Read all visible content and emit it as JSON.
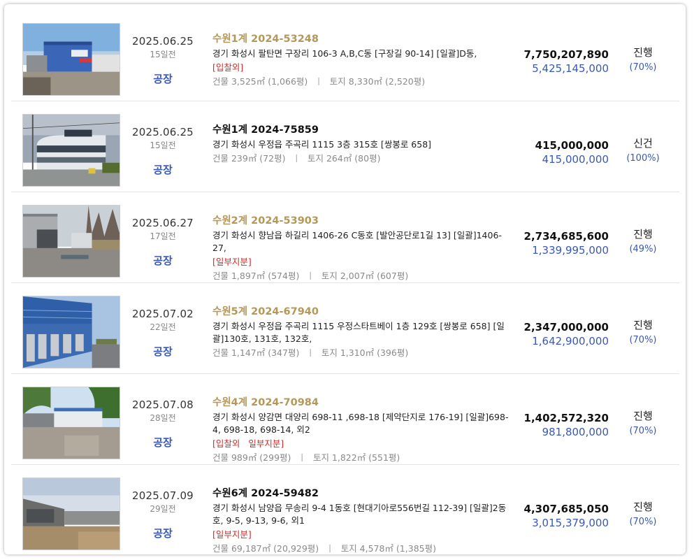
{
  "listings": [
    {
      "date": "2025.06.25",
      "days_left": "15일전",
      "category": "공장",
      "case_no": "수원1계 2024-53248",
      "case_style": "gold",
      "address": "경기 화성시 팔탄면 구장리 106-3 A,B,C동 [구장길 90-14] [일괄]D동,",
      "tags": [
        "[입찰외]"
      ],
      "building_area": "건물 3,525㎡ (1,066평)",
      "land_area": "토지 8,330㎡ (2,520평)",
      "appraised_price": "7,750,207,890",
      "min_price": "5,425,145,000",
      "status": "진행",
      "percent": "(70%)"
    },
    {
      "date": "2025.06.25",
      "days_left": "15일전",
      "category": "공장",
      "case_no": "수원1계 2024-75859",
      "case_style": "black",
      "address": "경기 화성시 우정읍 주곡리 1115 3층 315호 [쌍봉로 658]",
      "tags": [],
      "building_area": "건물 239㎡ (72평)",
      "land_area": "토지 264㎡ (80평)",
      "appraised_price": "415,000,000",
      "min_price": "415,000,000",
      "status": "신건",
      "percent": "(100%)"
    },
    {
      "date": "2025.06.27",
      "days_left": "17일전",
      "category": "공장",
      "case_no": "수원2계 2024-53903",
      "case_style": "gold",
      "address": "경기 화성시 향남읍 하길리 1406-26 C동호 [발안공단로1길 13] [일괄]1406-27,",
      "tags": [
        "[일부지분]"
      ],
      "building_area": "건물 1,897㎡ (574평)",
      "land_area": "토지 2,007㎡ (607평)",
      "appraised_price": "2,734,685,600",
      "min_price": "1,339,995,000",
      "status": "진행",
      "percent": "(49%)"
    },
    {
      "date": "2025.07.02",
      "days_left": "22일전",
      "category": "공장",
      "case_no": "수원5계 2024-67940",
      "case_style": "gold",
      "address": "경기 화성시 우정읍 주곡리 1115 우정스타트베이 1층 129호 [쌍봉로 658] [일괄]130호, 131호, 132호,",
      "tags": [],
      "building_area": "건물 1,147㎡ (347평)",
      "land_area": "토지 1,310㎡ (396평)",
      "appraised_price": "2,347,000,000",
      "min_price": "1,642,900,000",
      "status": "진행",
      "percent": "(70%)"
    },
    {
      "date": "2025.07.08",
      "days_left": "28일전",
      "category": "공장",
      "case_no": "수원4계 2024-70984",
      "case_style": "gold",
      "address": "경기 화성시 양감면 대양리 698-11 ,698-18 [제약단지로 176-19] [일괄]698-4, 698-18, 698-14, 외2",
      "tags": [
        "[입찰외",
        "일부지분]"
      ],
      "building_area": "건물 989㎡ (299평)",
      "land_area": "토지 1,822㎡ (551평)",
      "appraised_price": "1,402,572,320",
      "min_price": "981,800,000",
      "status": "진행",
      "percent": "(70%)"
    },
    {
      "date": "2025.07.09",
      "days_left": "29일전",
      "category": "공장",
      "case_no": "수원6계 2024-59482",
      "case_style": "black",
      "address": "경기 화성시 남양읍 무송리 9-4 1동호 [현대기아로556번길 112-39] [일괄]2동호, 9-5, 9-13, 9-6, 외1",
      "tags": [
        "[일부지분]"
      ],
      "building_area": "건물 69,187㎡ (20,929평)",
      "land_area": "토지 4,578㎡ (1,385평)",
      "appraised_price": "4,307,685,050",
      "min_price": "3,015,379,000",
      "status": "진행",
      "percent": "(70%)"
    }
  ],
  "area_separator": "ㅣ",
  "thumbnails": [
    "factory-blue-building-photo",
    "factory-round-building-photo",
    "factory-yard-photo",
    "factory-blue-facade-photo",
    "factory-lot-photo",
    "factory-dirt-yard-photo"
  ]
}
